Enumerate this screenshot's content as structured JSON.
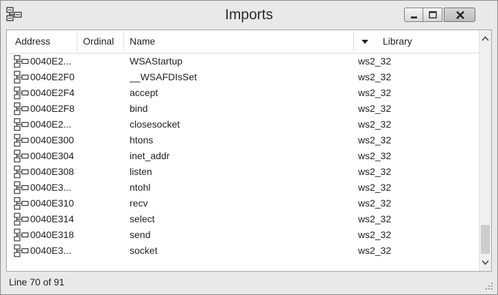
{
  "window": {
    "title": "Imports"
  },
  "columns": {
    "address": "Address",
    "ordinal": "Ordinal",
    "name": "Name",
    "library": "Library"
  },
  "rows": [
    {
      "address": "0040E2...",
      "ordinal": "",
      "name": "WSAStartup",
      "library": "ws2_32"
    },
    {
      "address": "0040E2F0",
      "ordinal": "",
      "name": "__WSAFDIsSet",
      "library": "ws2_32"
    },
    {
      "address": "0040E2F4",
      "ordinal": "",
      "name": "accept",
      "library": "ws2_32"
    },
    {
      "address": "0040E2F8",
      "ordinal": "",
      "name": "bind",
      "library": "ws2_32"
    },
    {
      "address": "0040E2...",
      "ordinal": "",
      "name": "closesocket",
      "library": "ws2_32"
    },
    {
      "address": "0040E300",
      "ordinal": "",
      "name": "htons",
      "library": "ws2_32"
    },
    {
      "address": "0040E304",
      "ordinal": "",
      "name": "inet_addr",
      "library": "ws2_32"
    },
    {
      "address": "0040E308",
      "ordinal": "",
      "name": "listen",
      "library": "ws2_32"
    },
    {
      "address": "0040E3...",
      "ordinal": "",
      "name": "ntohl",
      "library": "ws2_32"
    },
    {
      "address": "0040E310",
      "ordinal": "",
      "name": "recv",
      "library": "ws2_32"
    },
    {
      "address": "0040E314",
      "ordinal": "",
      "name": "select",
      "library": "ws2_32"
    },
    {
      "address": "0040E318",
      "ordinal": "",
      "name": "send",
      "library": "ws2_32"
    },
    {
      "address": "0040E3...",
      "ordinal": "",
      "name": "socket",
      "library": "ws2_32"
    }
  ],
  "status": {
    "text": "Line 70 of 91"
  },
  "icons": {
    "app": "imports-icon",
    "row": "import-entry-icon",
    "sort": "sort-descending-icon"
  },
  "colors": {
    "window_bg": "#e9e9e9",
    "list_bg": "#ffffff",
    "text": "#1e1e1e"
  }
}
